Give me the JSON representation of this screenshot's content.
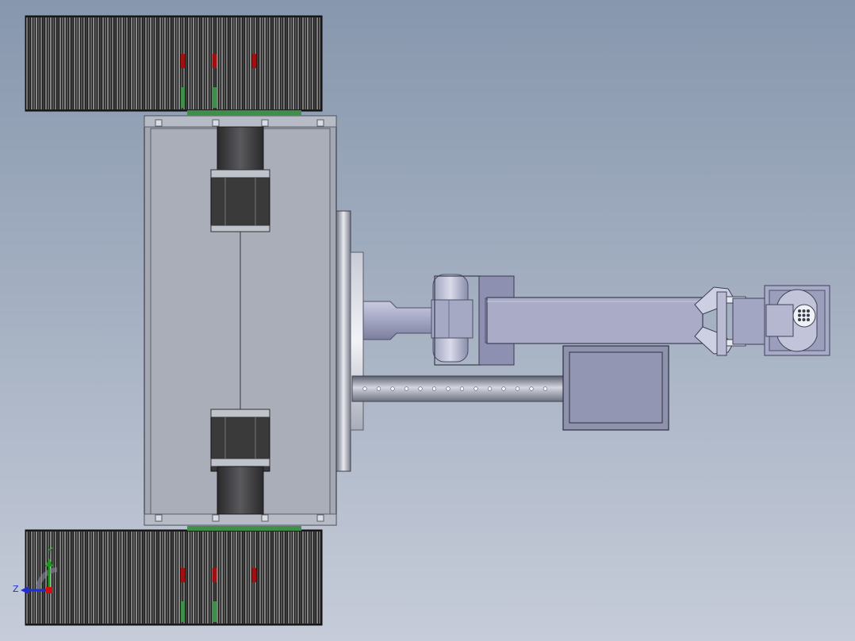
{
  "viewport": {
    "background_top": "#8797ad",
    "background_bottom": "#c6ccd9"
  },
  "model": {
    "components": [
      "track-left",
      "track-right",
      "chassis-frame",
      "drive-motor-top",
      "drive-motor-bottom",
      "turntable-base",
      "shoulder-joint",
      "upper-arm",
      "control-box",
      "perforated-boom",
      "wrist-joint",
      "gripper",
      "end-effector-camera"
    ],
    "colors": {
      "track": "#1c1c1c",
      "chassis": "#a3a8b3",
      "motor": "#3a3a3a",
      "arm": "#a7abc4",
      "accent_red": "#a01010",
      "accent_green": "#3f8e4a"
    }
  },
  "triad": {
    "y_label": "Y",
    "z_label": "Z",
    "icon": "coordinate-triad-icon"
  }
}
